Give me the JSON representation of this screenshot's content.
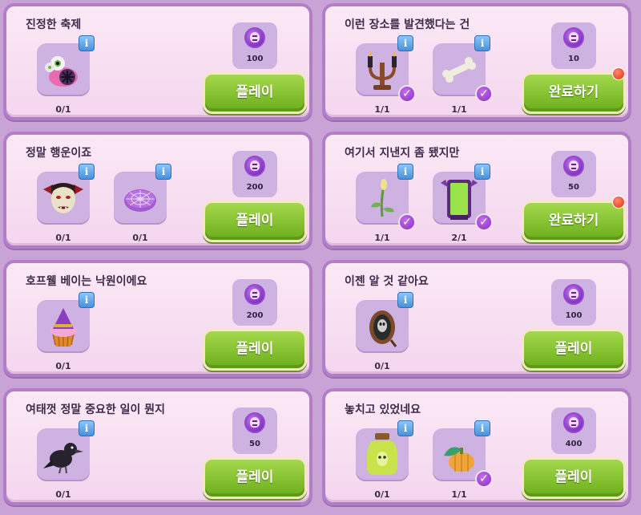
{
  "quests": [
    {
      "title": "진정한 축제",
      "items": [
        {
          "icon": "eyeball-cake-icon",
          "count": "0/1",
          "done": false
        }
      ],
      "reward": "100",
      "button": "플레이",
      "notify": false
    },
    {
      "title": "이런 장소를 발견했다는 건",
      "items": [
        {
          "icon": "candelabra-icon",
          "count": "1/1",
          "done": true
        },
        {
          "icon": "bone-icon",
          "count": "1/1",
          "done": true
        }
      ],
      "reward": "10",
      "button": "완료하기",
      "notify": true
    },
    {
      "title": "정말 행운이죠",
      "items": [
        {
          "icon": "vampire-mask-icon",
          "count": "0/1",
          "done": false
        },
        {
          "icon": "spiderweb-donut-icon",
          "count": "0/1",
          "done": false
        }
      ],
      "reward": "200",
      "button": "플레이",
      "notify": false
    },
    {
      "title": "여기서 지낸지 좀 됐지만",
      "items": [
        {
          "icon": "sprout-icon",
          "count": "1/1",
          "done": true
        },
        {
          "icon": "magic-mirror-icon",
          "count": "2/1",
          "done": true
        }
      ],
      "reward": "50",
      "button": "완료하기",
      "notify": true
    },
    {
      "title": "호프웰 베이는 낙원이에요",
      "items": [
        {
          "icon": "witch-cupcake-icon",
          "count": "0/1",
          "done": false
        }
      ],
      "reward": "200",
      "button": "플레이",
      "notify": false
    },
    {
      "title": "이젠 알 것 같아요",
      "items": [
        {
          "icon": "ghost-portrait-icon",
          "count": "0/1",
          "done": false
        }
      ],
      "reward": "100",
      "button": "플레이",
      "notify": false
    },
    {
      "title": "여태껏 정말 중요한 일이 뭔지",
      "items": [
        {
          "icon": "crow-icon",
          "count": "0/1",
          "done": false
        }
      ],
      "reward": "50",
      "button": "플레이",
      "notify": false
    },
    {
      "title": "놓치고 있었네요",
      "items": [
        {
          "icon": "potion-jar-icon",
          "count": "0/1",
          "done": false
        },
        {
          "icon": "pumpkin-icon",
          "count": "1/1",
          "done": true
        }
      ],
      "reward": "400",
      "button": "플레이",
      "notify": false
    }
  ],
  "labels": {
    "info": "i",
    "check": "✓"
  }
}
